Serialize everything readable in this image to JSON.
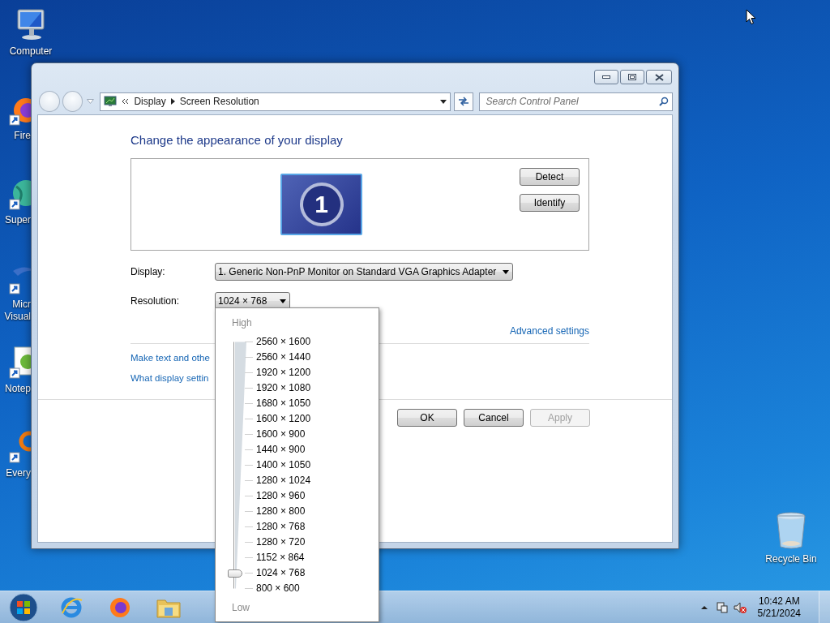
{
  "desktop": {
    "icons": [
      {
        "label": "Computer",
        "kind": "computer",
        "cut": false
      },
      {
        "label": "Fire",
        "kind": "firefox",
        "cut": true
      },
      {
        "label": "Super",
        "kind": "globe",
        "cut": true
      },
      {
        "label": "Micr Visual",
        "kind": "studio",
        "cut": true
      },
      {
        "label": "Notep",
        "kind": "notepad",
        "cut": true
      },
      {
        "label": "Every",
        "kind": "search",
        "cut": true
      }
    ],
    "recycle_bin": {
      "label": "Recycle Bin"
    }
  },
  "window": {
    "breadcrumb": [
      "Display",
      "Screen Resolution"
    ],
    "search": {
      "placeholder": "Search Control Panel"
    },
    "heading": "Change the appearance of your display",
    "monitor_number": "1",
    "side_buttons": [
      "Detect",
      "Identify"
    ],
    "display": {
      "label": "Display:",
      "value": "1. Generic Non-PnP Monitor on Standard VGA Graphics Adapter"
    },
    "resolution": {
      "label": "Resolution:",
      "value": "1024 × 768"
    },
    "advanced_link": "Advanced settings",
    "links": [
      "Make text and othe",
      "What display settin"
    ],
    "buttons": [
      {
        "label": "OK",
        "disabled": false
      },
      {
        "label": "Cancel",
        "disabled": false
      },
      {
        "label": "Apply",
        "disabled": true
      }
    ]
  },
  "resolution_menu": {
    "high_label": "High",
    "low_label": "Low",
    "level": 0.0625,
    "options": [
      "2560 × 1600",
      "2560 × 1440",
      "1920 × 1200",
      "1920 × 1080",
      "1680 × 1050",
      "1600 × 1200",
      "1600 × 900",
      "1440 × 900",
      "1400 × 1050",
      "1280 × 1024",
      "1280 × 960",
      "1280 × 800",
      "1280 × 768",
      "1280 × 720",
      "1152 × 864",
      "1024 × 768",
      "800 × 600"
    ]
  },
  "taskbar": {
    "apps": [
      {
        "kind": "ie"
      },
      {
        "kind": "firefox"
      },
      {
        "kind": "explorer"
      }
    ],
    "clock": {
      "time": "10:42 AM",
      "date": "5/21/2024"
    }
  }
}
